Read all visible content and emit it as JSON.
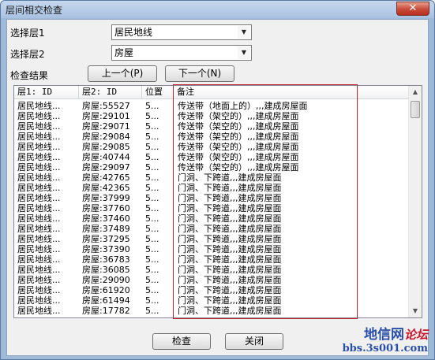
{
  "window": {
    "title": "层间相交检查",
    "close_glyph": "✕"
  },
  "form": {
    "layer1_label": "选择层1",
    "layer1_value": "居民地线",
    "layer2_label": "选择层2",
    "layer2_value": "房屋",
    "result_label": "检查结果",
    "prev_button": "上一个(P)",
    "next_button": "下一个(N)"
  },
  "table": {
    "columns": [
      "层1: ID",
      "层2: ID",
      "位置",
      "备注"
    ],
    "rows": [
      [
        "居民地线...",
        "房屋:55527",
        "5...",
        "传送带（地面上的）,,,建成房屋面"
      ],
      [
        "居民地线...",
        "房屋:29101",
        "5...",
        "传送带（架空的）,,,建成房屋面"
      ],
      [
        "居民地线...",
        "房屋:29071",
        "5...",
        "传送带（架空的）,,,建成房屋面"
      ],
      [
        "居民地线...",
        "房屋:29084",
        "5...",
        "传送带（架空的）,,,建成房屋面"
      ],
      [
        "居民地线...",
        "房屋:29085",
        "5...",
        "传送带（架空的）,,,建成房屋面"
      ],
      [
        "居民地线...",
        "房屋:40744",
        "5...",
        "传送带（架空的）,,,建成房屋面"
      ],
      [
        "居民地线...",
        "房屋:29097",
        "5...",
        "传送带（架空的）,,,建成房屋面"
      ],
      [
        "居民地线...",
        "房屋:42765",
        "5...",
        "门洞、下跨道,,,建成房屋面"
      ],
      [
        "居民地线...",
        "房屋:42365",
        "5...",
        "门洞、下跨道,,,建成房屋面"
      ],
      [
        "居民地线...",
        "房屋:37999",
        "5...",
        "门洞、下跨道,,,建成房屋面"
      ],
      [
        "居民地线...",
        "房屋:37760",
        "5...",
        "门洞、下跨道,,,建成房屋面"
      ],
      [
        "居民地线...",
        "房屋:37460",
        "5...",
        "门洞、下跨道,,,建成房屋面"
      ],
      [
        "居民地线...",
        "房屋:37489",
        "5...",
        "门洞、下跨道,,,建成房屋面"
      ],
      [
        "居民地线...",
        "房屋:37295",
        "5...",
        "门洞、下跨道,,,建成房屋面"
      ],
      [
        "居民地线...",
        "房屋:37390",
        "5...",
        "门洞、下跨道,,,建成房屋面"
      ],
      [
        "居民地线...",
        "房屋:36783",
        "5...",
        "门洞、下跨道,,,建成房屋面"
      ],
      [
        "居民地线...",
        "房屋:36085",
        "5...",
        "门洞、下跨道,,,建成房屋面"
      ],
      [
        "居民地线...",
        "房屋:29090",
        "5...",
        "门洞、下跨道,,,建成房屋面"
      ],
      [
        "居民地线...",
        "房屋:61920",
        "5...",
        "门洞、下跨道,,,建成房屋面"
      ],
      [
        "居民地线...",
        "房屋:61494",
        "5...",
        "门洞、下跨道,,,建成房屋面"
      ],
      [
        "居民地线...",
        "房屋:17782",
        "5...",
        "门洞、下跨道,,,建成房屋面"
      ]
    ]
  },
  "footer": {
    "check_button": "检查",
    "close_button": "关闭"
  },
  "watermark": {
    "line1": "地信网",
    "line1_accent": "论坛",
    "line2": "bbs.3s001.com"
  },
  "colors": {
    "highlight_box": "#c0232b",
    "window_frame": "#9fb9d8"
  }
}
